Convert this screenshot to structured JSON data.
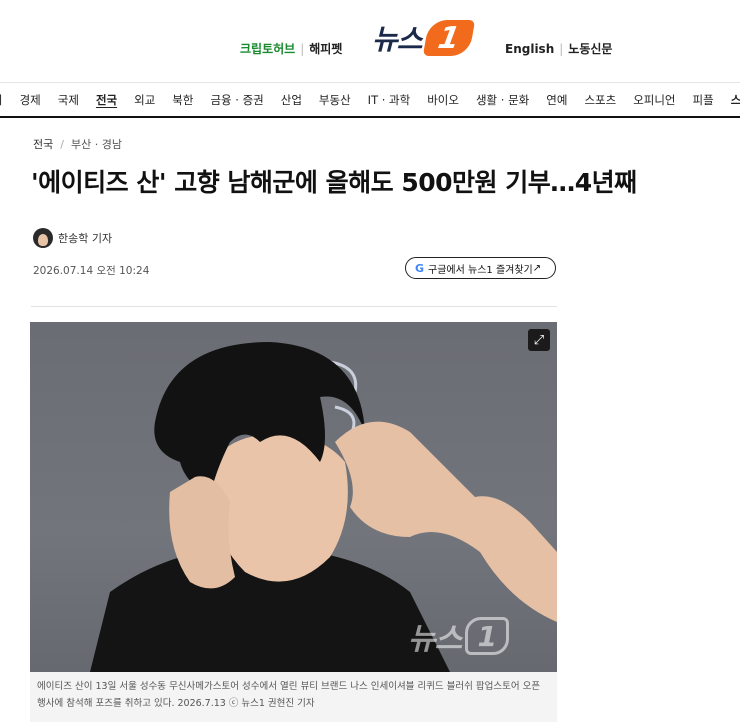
{
  "header": {
    "left_links": [
      "크립토허브",
      "해피펫"
    ],
    "logo_text": "뉴스",
    "logo_badge": "1",
    "right_links": [
      "English",
      "노동신문"
    ],
    "colors": {
      "brand_orange": "#f26a1b",
      "brand_navy": "#1b2a4b",
      "green_link": "#1a8a2e"
    }
  },
  "nav": {
    "items": [
      "회",
      "경제",
      "국제",
      "전국",
      "외교",
      "북한",
      "금융 · 증권",
      "산업",
      "부동산",
      "IT · 과학",
      "바이오",
      "생활 · 문화",
      "연예",
      "스포츠",
      "오피니언",
      "피플",
      "스"
    ],
    "active": "전국"
  },
  "article": {
    "breadcrumb": [
      "전국",
      "부산 · 경남"
    ],
    "title": "'에이티즈 산' 고향 남해군에 올해도 500만원 기부…4년째",
    "reporter": "한송학 기자",
    "datetime": "2026.07.14 오전 10:24",
    "google_button": "구글에서 뉴스1 즐겨찾기",
    "google_icon": "G",
    "photo": {
      "expand_icon": "expand-icon",
      "watermark_text": "뉴스",
      "watermark_badge": "1"
    },
    "caption": "에이티즈 산이 13일 서울 성수동 무신사메가스토어 성수에서 열린 뷰티 브랜드 나스 인세이셔블 리퀴드 블러쉬 팝업스토어 오픈 행사에 참석해 포즈를 취하고 있다. 2026.7.13 ⓒ 뉴스1 권현진 기자"
  }
}
